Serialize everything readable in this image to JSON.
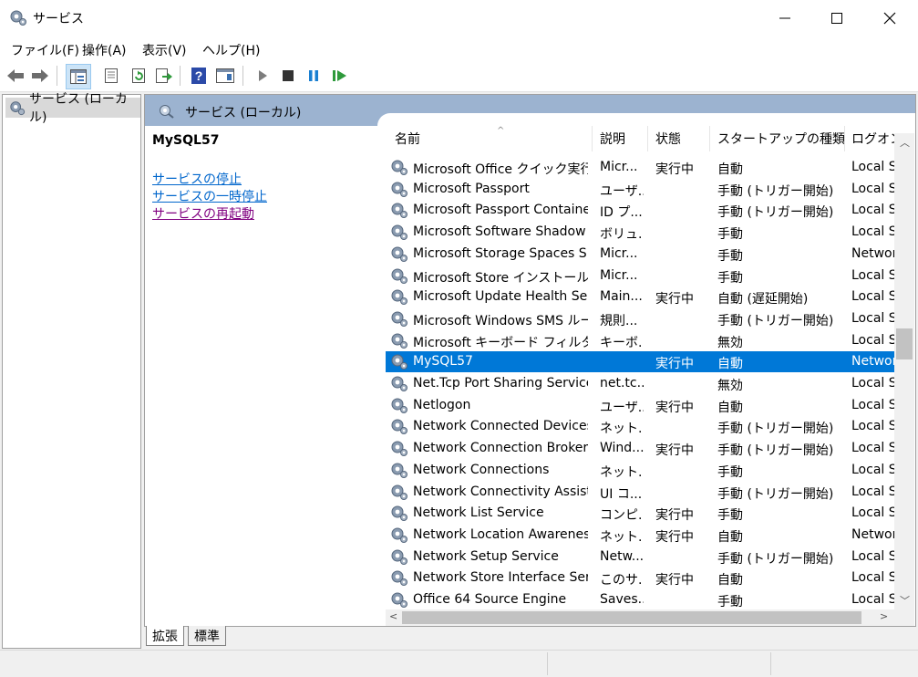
{
  "window": {
    "title": "サービス"
  },
  "menu": [
    "ファイル(F)",
    "操作(A)",
    "表示(V)",
    "ヘルプ(H)"
  ],
  "tree": {
    "root_label": "サービス (ローカル)"
  },
  "panel": {
    "header": "サービス (ローカル)",
    "selected_name": "MySQL57",
    "actions": [
      {
        "label": "サービスの停止"
      },
      {
        "label": "サービスの一時停止"
      },
      {
        "label": "サービスの再起動"
      }
    ]
  },
  "columns": [
    "名前",
    "説明",
    "状態",
    "スタートアップの種類",
    "ログオン"
  ],
  "rows": [
    {
      "name": "Microsoft Office クイック実行...",
      "desc": "Micr...",
      "status": "実行中",
      "startup": "自動",
      "logon": "Local S..."
    },
    {
      "name": "Microsoft Passport",
      "desc": "ユーザ...",
      "status": "",
      "startup": "手動 (トリガー開始)",
      "logon": "Local S..."
    },
    {
      "name": "Microsoft Passport Container",
      "desc": "ID プ...",
      "status": "",
      "startup": "手動 (トリガー開始)",
      "logon": "Local S..."
    },
    {
      "name": "Microsoft Software Shadow ...",
      "desc": "ボリュ...",
      "status": "",
      "startup": "手動",
      "logon": "Local S..."
    },
    {
      "name": "Microsoft Storage Spaces S...",
      "desc": "Micr...",
      "status": "",
      "startup": "手動",
      "logon": "Networ"
    },
    {
      "name": "Microsoft Store インストール サ...",
      "desc": "Micr...",
      "status": "",
      "startup": "手動",
      "logon": "Local S..."
    },
    {
      "name": "Microsoft Update Health Ser...",
      "desc": "Main...",
      "status": "実行中",
      "startup": "自動 (遅延開始)",
      "logon": "Local S..."
    },
    {
      "name": "Microsoft Windows SMS ルー...",
      "desc": "規則...",
      "status": "",
      "startup": "手動 (トリガー開始)",
      "logon": "Local S..."
    },
    {
      "name": "Microsoft キーボード フィルター",
      "desc": "キーボ...",
      "status": "",
      "startup": "無効",
      "logon": "Local S..."
    },
    {
      "name": "MySQL57",
      "desc": "",
      "status": "実行中",
      "startup": "自動",
      "logon": "Networ",
      "selected": true
    },
    {
      "name": "Net.Tcp Port Sharing Service",
      "desc": "net.tc...",
      "status": "",
      "startup": "無効",
      "logon": "Local S..."
    },
    {
      "name": "Netlogon",
      "desc": "ユーザ...",
      "status": "実行中",
      "startup": "自動",
      "logon": "Local S..."
    },
    {
      "name": "Network Connected Devices ...",
      "desc": "ネット...",
      "status": "",
      "startup": "手動 (トリガー開始)",
      "logon": "Local S..."
    },
    {
      "name": "Network Connection Broker",
      "desc": "Wind...",
      "status": "実行中",
      "startup": "手動 (トリガー開始)",
      "logon": "Local S..."
    },
    {
      "name": "Network Connections",
      "desc": "ネット...",
      "status": "",
      "startup": "手動",
      "logon": "Local S..."
    },
    {
      "name": "Network Connectivity Assist...",
      "desc": "UI コ...",
      "status": "",
      "startup": "手動 (トリガー開始)",
      "logon": "Local S..."
    },
    {
      "name": "Network List Service",
      "desc": "コンピ...",
      "status": "実行中",
      "startup": "手動",
      "logon": "Local S..."
    },
    {
      "name": "Network Location Awareness",
      "desc": "ネット...",
      "status": "実行中",
      "startup": "自動",
      "logon": "Networ"
    },
    {
      "name": "Network Setup Service",
      "desc": "Netw...",
      "status": "",
      "startup": "手動 (トリガー開始)",
      "logon": "Local S..."
    },
    {
      "name": "Network Store Interface Serv...",
      "desc": "このサ...",
      "status": "実行中",
      "startup": "自動",
      "logon": "Local S..."
    },
    {
      "name": "Office 64 Source Engine",
      "desc": "Saves...",
      "status": "",
      "startup": "手動",
      "logon": "Local S..."
    }
  ],
  "tabs": [
    "拡張",
    "標準"
  ],
  "icons": [
    "gear-icon",
    "back-icon",
    "forward-icon",
    "console-tree-icon",
    "properties-icon",
    "refresh-icon",
    "export-icon",
    "help-icon",
    "view-icon",
    "play-icon",
    "stop-icon",
    "pause-icon",
    "restart-icon"
  ]
}
